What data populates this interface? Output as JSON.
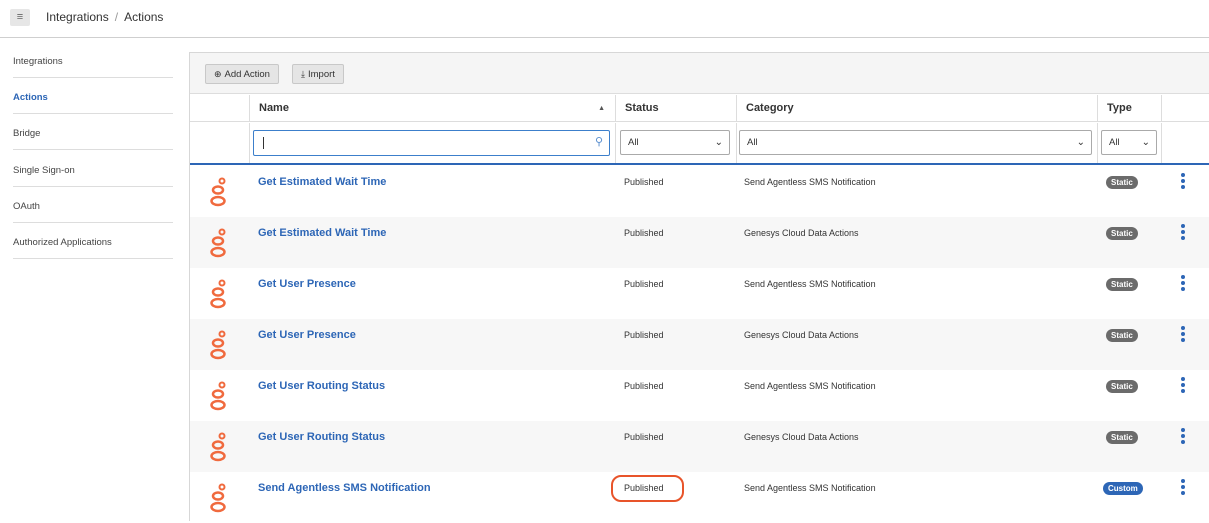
{
  "topbar": {
    "menu_icon": "hamburger-icon",
    "breadcrumb": {
      "parent": "Integrations",
      "separator": "/",
      "current": "Actions"
    }
  },
  "sidebar": {
    "items": [
      {
        "label": "Integrations",
        "active": false
      },
      {
        "label": "Actions",
        "active": true
      },
      {
        "label": "Bridge",
        "active": false
      },
      {
        "label": "Single Sign-on",
        "active": false
      },
      {
        "label": "OAuth",
        "active": false
      },
      {
        "label": "Authorized Applications",
        "active": false
      }
    ]
  },
  "toolbar": {
    "add_action_label": "Add Action",
    "import_label": "Import"
  },
  "table": {
    "headers": {
      "name": "Name",
      "status": "Status",
      "category": "Category",
      "type": "Type"
    },
    "filters": {
      "search_value": "",
      "status": "All",
      "category": "All",
      "type": "All"
    },
    "rows": [
      {
        "name": "Get Estimated Wait Time",
        "status": "Published",
        "category": "Send Agentless SMS Notification",
        "type": "Static"
      },
      {
        "name": "Get Estimated Wait Time",
        "status": "Published",
        "category": "Genesys Cloud Data Actions",
        "type": "Static"
      },
      {
        "name": "Get User Presence",
        "status": "Published",
        "category": "Send Agentless SMS Notification",
        "type": "Static"
      },
      {
        "name": "Get User Presence",
        "status": "Published",
        "category": "Genesys Cloud Data Actions",
        "type": "Static"
      },
      {
        "name": "Get User Routing Status",
        "status": "Published",
        "category": "Send Agentless SMS Notification",
        "type": "Static"
      },
      {
        "name": "Get User Routing Status",
        "status": "Published",
        "category": "Genesys Cloud Data Actions",
        "type": "Static"
      },
      {
        "name": "Send Agentless SMS Notification",
        "status": "Published",
        "category": "Send Agentless SMS Notification",
        "type": "Custom"
      }
    ]
  },
  "colors": {
    "link": "#2d66b6",
    "logo": "#f06a3e",
    "static_badge": "#6b6b6b",
    "custom_badge": "#2d66b6",
    "highlight": "#e8542a"
  }
}
